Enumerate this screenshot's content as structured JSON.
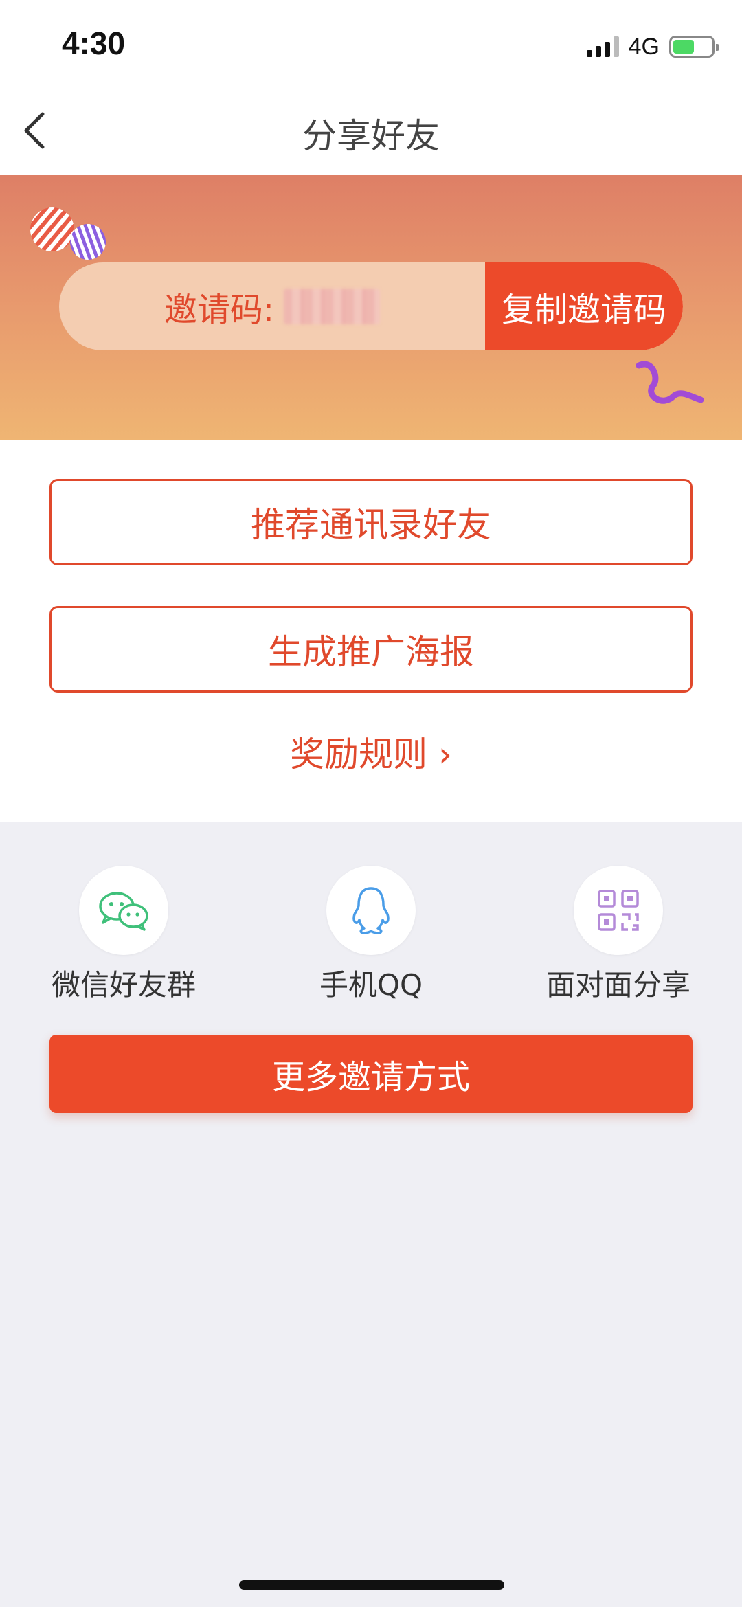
{
  "status": {
    "time": "4:30",
    "network": "4G"
  },
  "nav": {
    "title": "分享好友",
    "back_icon": "chevron-left-icon"
  },
  "invite": {
    "label": "邀请码:",
    "copy_button": "复制邀请码"
  },
  "actions": {
    "recommend_contacts": "推荐通讯录好友",
    "generate_poster": "生成推广海报",
    "reward_rules": "奖励规则 ›"
  },
  "share": {
    "items": [
      {
        "label": "微信好友群",
        "icon": "wechat-icon"
      },
      {
        "label": "手机QQ",
        "icon": "qq-icon"
      },
      {
        "label": "面对面分享",
        "icon": "qrcode-icon"
      }
    ]
  },
  "more": {
    "label": "更多邀请方式"
  },
  "colors": {
    "accent": "#ec4a2a",
    "accent_text": "#e0492c",
    "wechat": "#3fc07a",
    "qq": "#4a9de8",
    "qrcode": "#b48ad8"
  }
}
